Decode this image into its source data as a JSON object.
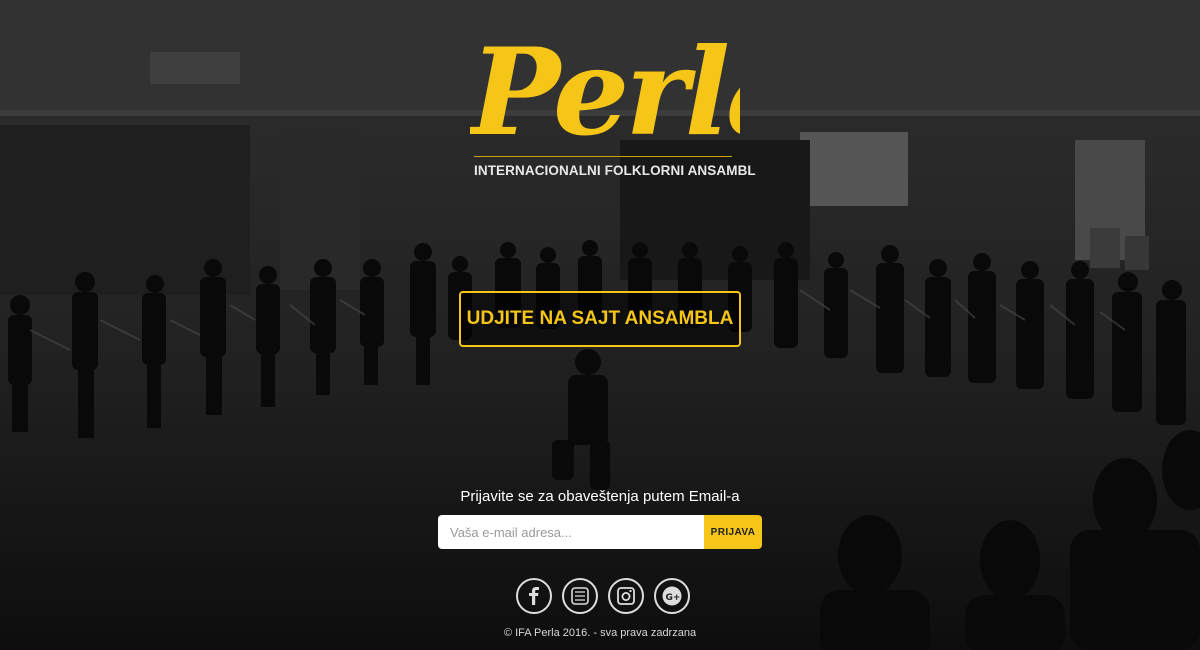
{
  "brand": {
    "logo_text": "Perla",
    "tagline": "INTERNACIONALNI FOLKLORNI ANSAMBL",
    "accent_color": "#f5c518"
  },
  "hero": {
    "cta_label": "UDJITE NA SAJT ANSAMBLA"
  },
  "subscribe": {
    "label": "Prijavite se za obaveštenja putem Email-a",
    "email_placeholder": "Vaša e-mail adresa...",
    "email_value": "",
    "submit_label": "PRIJAVA"
  },
  "social": [
    {
      "icon": "facebook-icon"
    },
    {
      "icon": "youtube-icon"
    },
    {
      "icon": "instagram-icon"
    },
    {
      "icon": "google-plus-icon"
    }
  ],
  "footer": {
    "copyright": "© IFA Perla 2016. - sva prava zadrzana"
  }
}
